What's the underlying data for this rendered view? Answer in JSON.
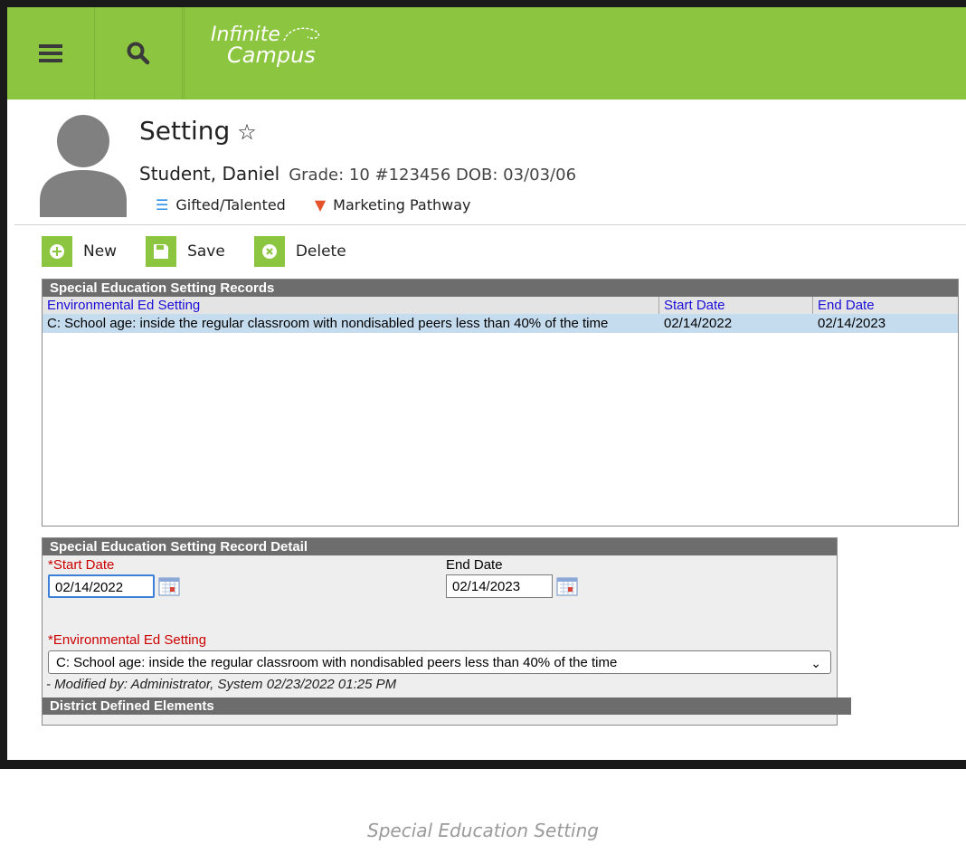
{
  "app": {
    "logo_line1": "Infinite",
    "logo_line2": "Campus"
  },
  "header": {
    "title": "Setting",
    "student_name": "Student, Daniel",
    "student_meta": "Grade: 10 #123456 DOB: 03/03/06",
    "flags": [
      {
        "label": "Gifted/Talented",
        "icon": "list-check-icon",
        "color": "#2f8fe6"
      },
      {
        "label": "Marketing Pathway",
        "icon": "pathway-icon",
        "color": "#e5532b"
      }
    ]
  },
  "toolbar": {
    "new_label": "New",
    "save_label": "Save",
    "delete_label": "Delete"
  },
  "records": {
    "title": "Special Education Setting Records",
    "columns": [
      "Environmental Ed Setting",
      "Start Date",
      "End Date"
    ],
    "rows": [
      {
        "setting": "C: School age: inside the regular classroom with nondisabled peers less than 40% of the time",
        "start": "02/14/2022",
        "end": "02/14/2023"
      }
    ]
  },
  "detail": {
    "title": "Special Education Setting Record Detail",
    "start_date_label": "*Start Date",
    "start_date_value": "02/14/2022",
    "end_date_label": "End Date",
    "end_date_value": "02/14/2023",
    "setting_label": "*Environmental Ed Setting",
    "setting_value": "C: School age: inside the regular classroom with nondisabled peers less than 40% of the time",
    "modified": "- Modified by: Administrator, System 02/23/2022 01:25 PM",
    "district_defined": "District Defined Elements"
  },
  "caption": "Special Education Setting",
  "colors": {
    "brand_green": "#8cc53f",
    "panel_header": "#6d6d6d",
    "selected_row": "#c5dcef",
    "link_blue": "#1a0dd8",
    "required_red": "#cc0000"
  }
}
